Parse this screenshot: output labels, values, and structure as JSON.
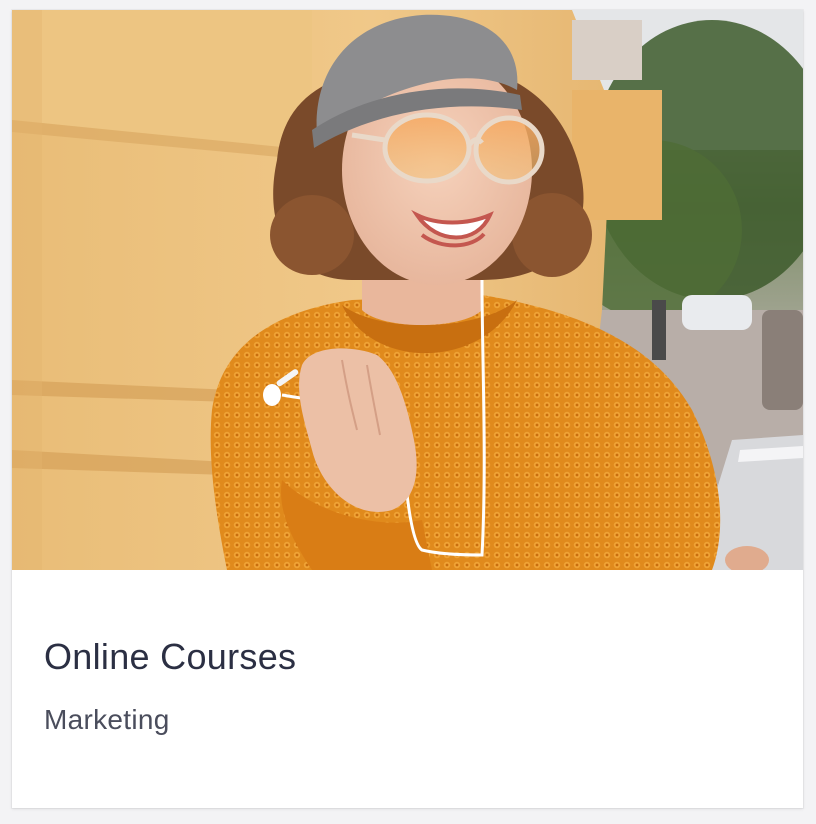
{
  "card": {
    "image_subject": "woman-with-earphones-photo",
    "title": "Online Courses",
    "subtitle": "Marketing"
  },
  "colors": {
    "title_text": "#2b2f43",
    "subtitle_text": "#4a4d5c",
    "card_background": "#ffffff",
    "page_background": "#f3f3f5"
  }
}
